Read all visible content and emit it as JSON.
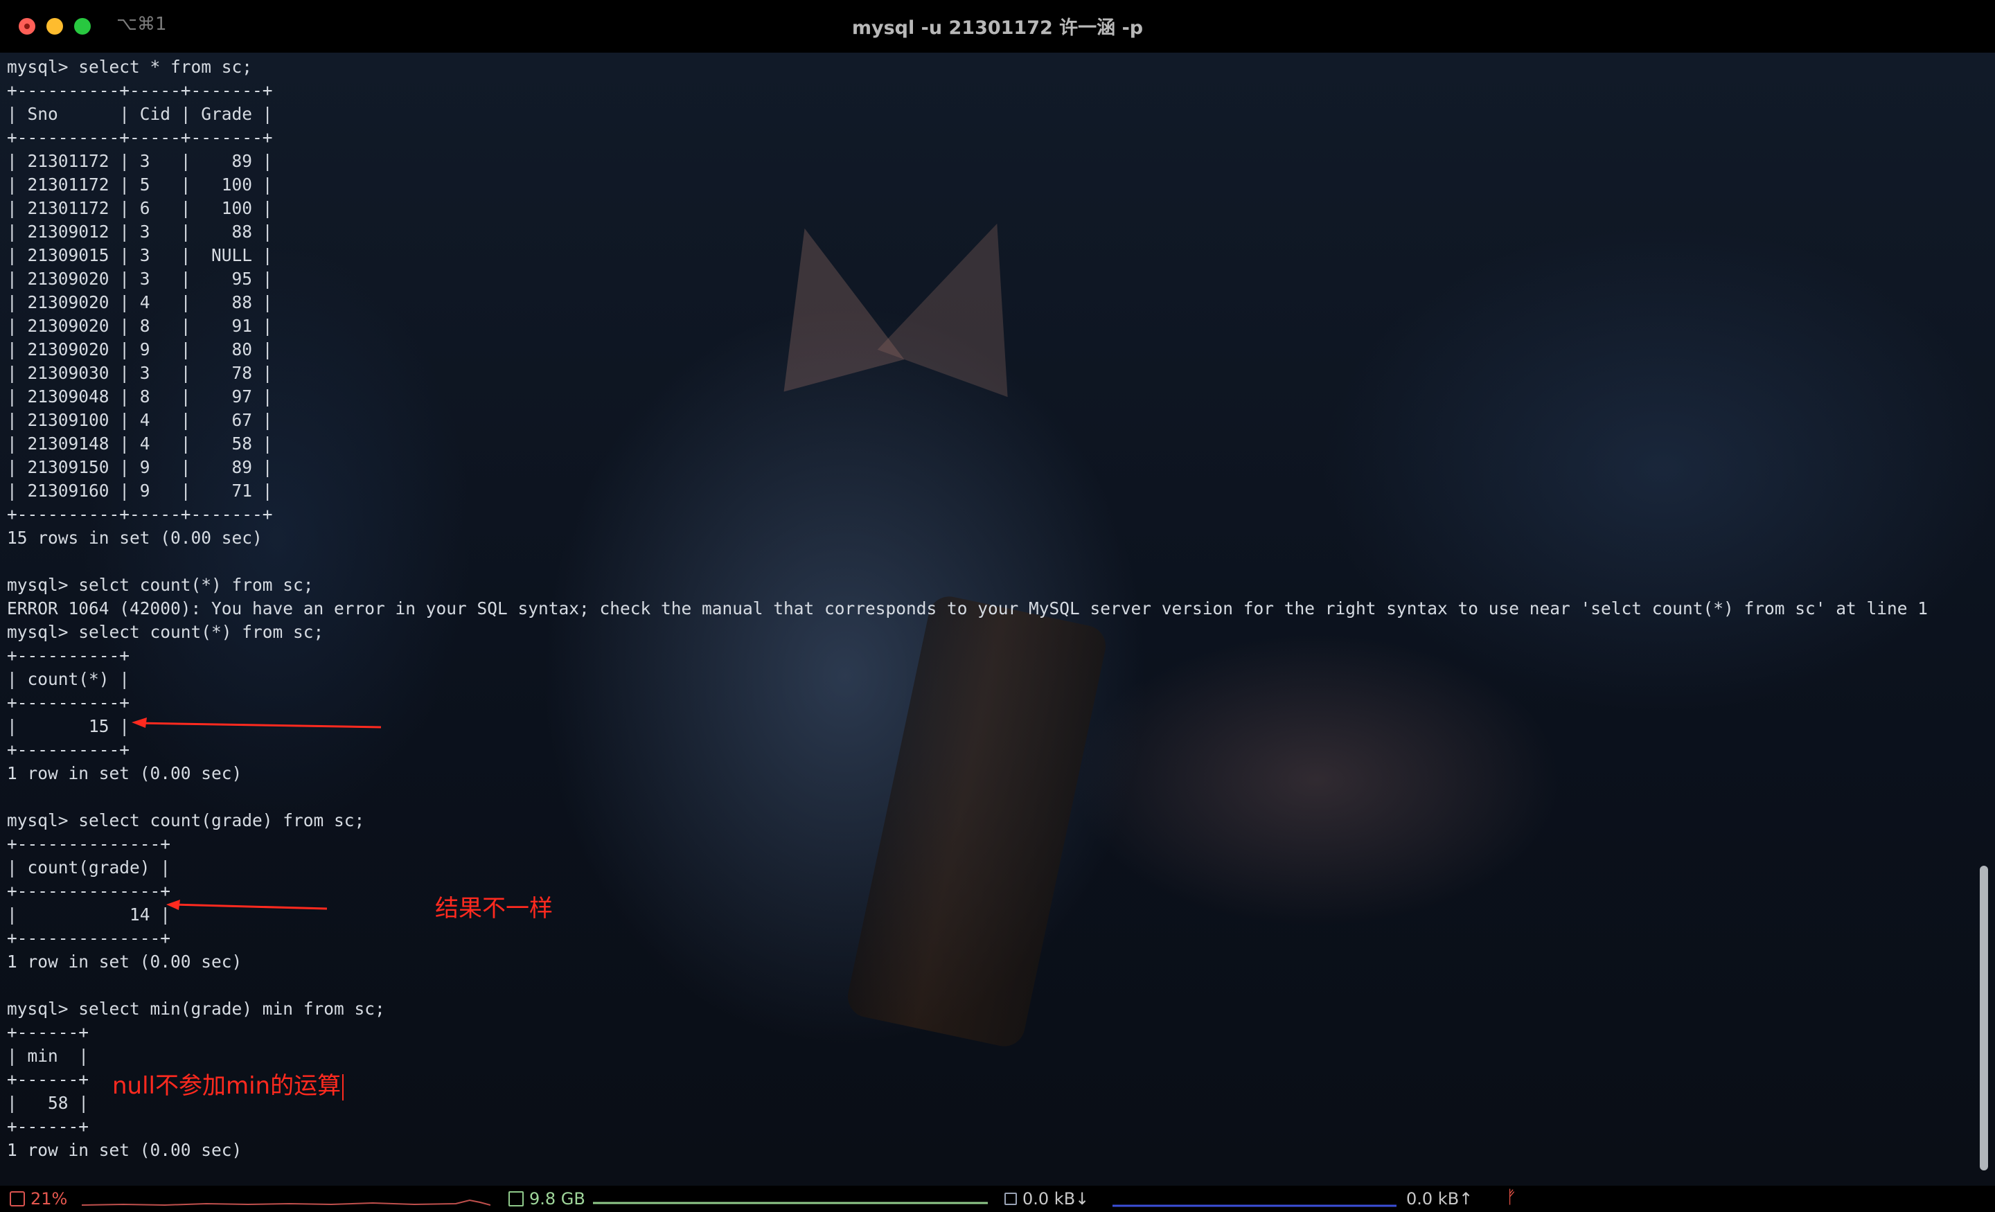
{
  "window": {
    "title": "mysql -u 21301172 许一涵 -p",
    "shortcut": "⌥⌘1"
  },
  "terminal_lines": [
    "mysql> select * from sc;",
    "+----------+-----+-------+",
    "| Sno      | Cid | Grade |",
    "+----------+-----+-------+",
    "| 21301172 | 3   |    89 |",
    "| 21301172 | 5   |   100 |",
    "| 21301172 | 6   |   100 |",
    "| 21309012 | 3   |    88 |",
    "| 21309015 | 3   |  NULL |",
    "| 21309020 | 3   |    95 |",
    "| 21309020 | 4   |    88 |",
    "| 21309020 | 8   |    91 |",
    "| 21309020 | 9   |    80 |",
    "| 21309030 | 3   |    78 |",
    "| 21309048 | 8   |    97 |",
    "| 21309100 | 4   |    67 |",
    "| 21309148 | 4   |    58 |",
    "| 21309150 | 9   |    89 |",
    "| 21309160 | 9   |    71 |",
    "+----------+-----+-------+",
    "15 rows in set (0.00 sec)",
    "",
    "mysql> selct count(*) from sc;",
    "ERROR 1064 (42000): You have an error in your SQL syntax; check the manual that corresponds to your MySQL server version for the right syntax to use near 'selct count(*) from sc' at line 1",
    "mysql> select count(*) from sc;",
    "+----------+",
    "| count(*) |",
    "+----------+",
    "|       15 |",
    "+----------+",
    "1 row in set (0.00 sec)",
    "",
    "mysql> select count(grade) from sc;",
    "+--------------+",
    "| count(grade) |",
    "+--------------+",
    "|           14 |",
    "+--------------+",
    "1 row in set (0.00 sec)",
    "",
    "mysql> select min(grade) min from sc;",
    "+------+",
    "| min  |",
    "+------+",
    "|   58 |",
    "+------+",
    "1 row in set (0.00 sec)"
  ],
  "annotations": {
    "result_differs": "结果不一样",
    "null_note": "null不参加min的运算"
  },
  "statusbar": {
    "cpu": "21%",
    "memory": "9.8 GB",
    "net_down": "0.0 kB↓",
    "net_up": "0.0 kB↑",
    "branch_glyph": "ᚠ"
  },
  "colors": {
    "annotation": "#ff2a1f",
    "terminal_text": "#d6dbe2",
    "cpu": "#d9534f",
    "memory": "#8fc98a",
    "network": "#3b4fd8"
  }
}
